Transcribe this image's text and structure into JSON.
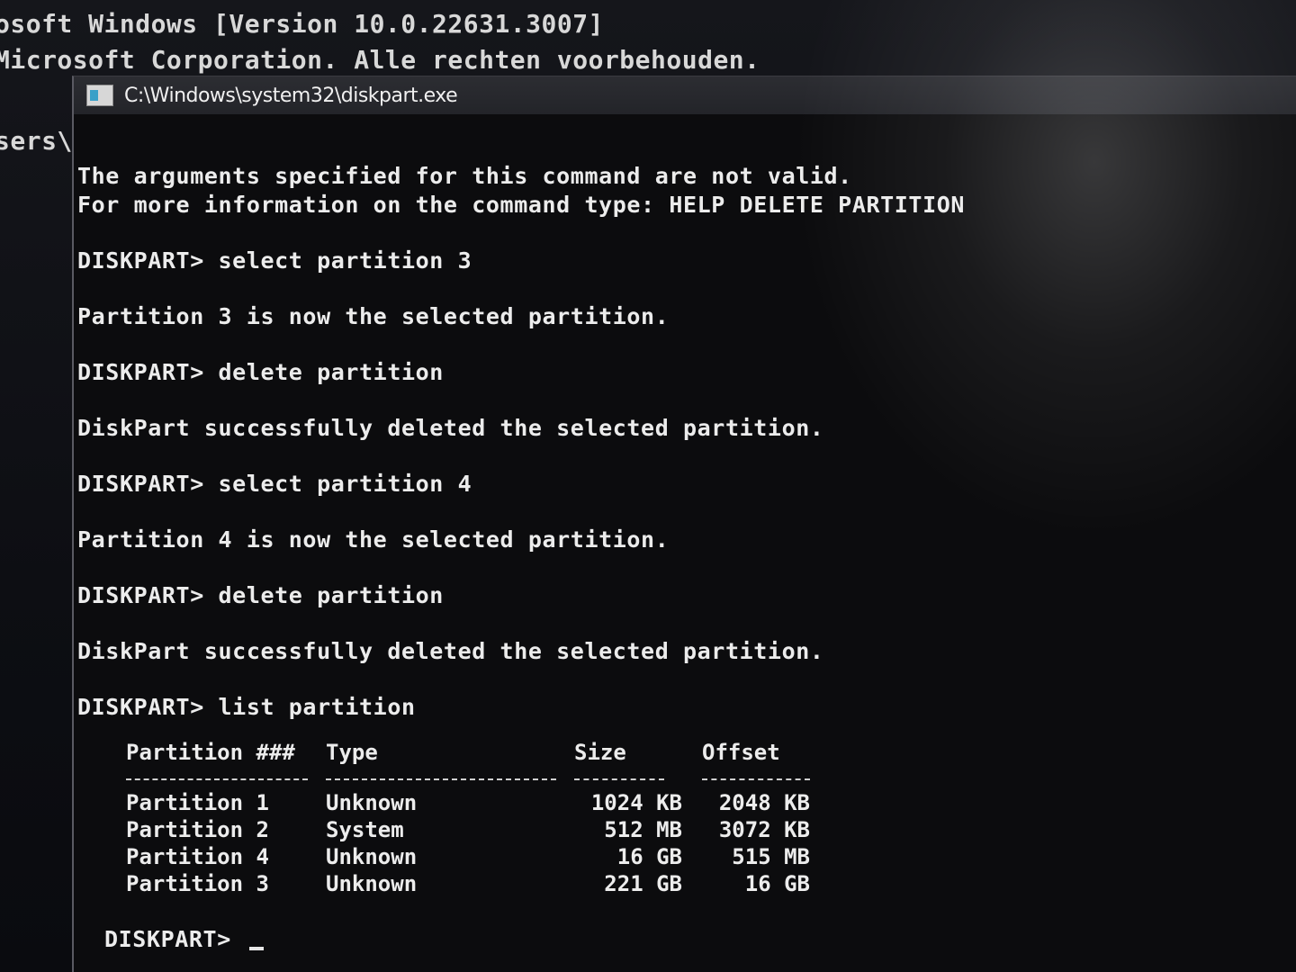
{
  "background_console": {
    "lines": [
      "osoft Windows [Version 10.0.22631.3007]",
      "Microsoft Corporation. Alle rechten voorbehouden.",
      "sers\\"
    ]
  },
  "window": {
    "title": "C:\\Windows\\system32\\diskpart.exe"
  },
  "console": {
    "lines": [
      "The arguments specified for this command are not valid.",
      "For more information on the command type: HELP DELETE PARTITION",
      "DISKPART> select partition 3",
      "Partition 3 is now the selected partition.",
      "DISKPART> delete partition",
      "DiskPart successfully deleted the selected partition.",
      "DISKPART> select partition 4",
      "Partition 4 is now the selected partition.",
      "DISKPART> delete partition",
      "DiskPart successfully deleted the selected partition.",
      "DISKPART> list partition"
    ],
    "prompt": "DISKPART> "
  },
  "partition_table": {
    "headers": [
      "Partition ###",
      "Type",
      "Size",
      "Offset"
    ],
    "rows": [
      {
        "partition": "Partition 1",
        "type": "Unknown",
        "size": "1024 KB",
        "offset": "2048 KB"
      },
      {
        "partition": "Partition 2",
        "type": "System",
        "size": "512 MB",
        "offset": "3072 KB"
      },
      {
        "partition": "Partition 4",
        "type": "Unknown",
        "size": "16 GB",
        "offset": "515 MB"
      },
      {
        "partition": "Partition 3",
        "type": "Unknown",
        "size": "221 GB",
        "offset": "16 GB"
      }
    ]
  }
}
